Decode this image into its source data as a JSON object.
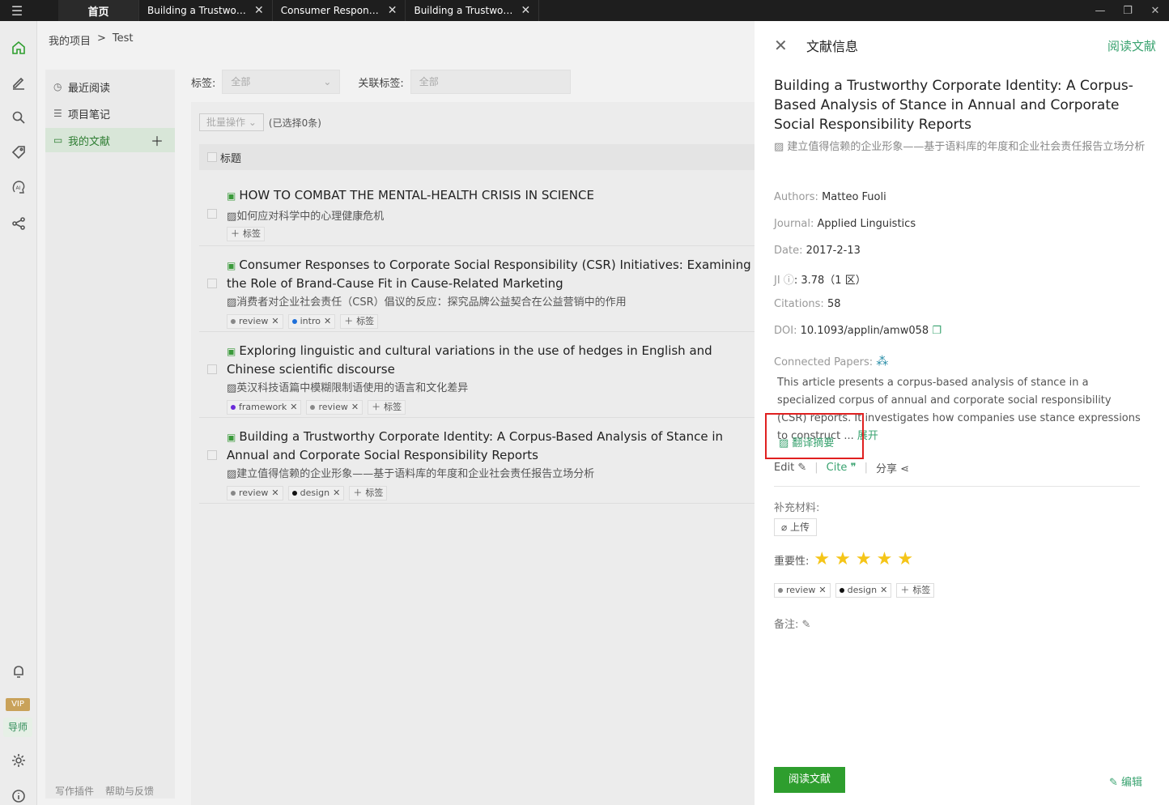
{
  "tabs": {
    "home": "首页",
    "items": [
      {
        "label": "Building a Trustworth..."
      },
      {
        "label": "Consumer Responses..."
      },
      {
        "label": "Building a Trustworth..."
      }
    ]
  },
  "breadcrumb": {
    "root": "我的项目",
    "sep": ">",
    "current": "Test"
  },
  "side_nav": {
    "recent": "最近阅读",
    "notes": "项目笔记",
    "my_docs": "我的文献"
  },
  "footer": {
    "plugins": "写作插件",
    "help": "帮助与反馈"
  },
  "rail": {
    "vip": "VIP",
    "mentor": "导师"
  },
  "filters": {
    "tag_label": "标签:",
    "tag_value": "全部",
    "related_label": "关联标签:",
    "related_value": "全部"
  },
  "list": {
    "batch_label": "批量操作",
    "selected": "(已选择0条)",
    "header_title": "标题",
    "add_tag": "标签",
    "rows": [
      {
        "title": "HOW TO COMBAT THE MENTAL-HEALTH CRISIS IN SCIENCE",
        "sub": "如何应对科学中的心理健康危机",
        "tags": []
      },
      {
        "title": "Consumer Responses to Corporate Social Responsibility (CSR) Initiatives: Examining the Role of Brand-Cause Fit in Cause-Related Marketing",
        "sub": "消费者对企业社会责任（CSR）倡议的反应：探究品牌公益契合在公益营销中的作用",
        "tags": [
          {
            "name": "review",
            "color": "#888888"
          },
          {
            "name": "intro",
            "color": "#1e6fd9"
          }
        ]
      },
      {
        "title": "Exploring linguistic and cultural variations in the use of hedges in English and Chinese scientific discourse",
        "sub": "英汉科技语篇中模糊限制语使用的语言和文化差异",
        "tags": [
          {
            "name": "framework",
            "color": "#6a2bd9"
          },
          {
            "name": "review",
            "color": "#888888"
          }
        ]
      },
      {
        "title": "Building a Trustworthy Corporate Identity: A Corpus-Based Analysis of Stance in Annual and Corporate Social Responsibility Reports",
        "sub": "建立值得信赖的企业形象——基于语料库的年度和企业社会责任报告立场分析",
        "tags": [
          {
            "name": "review",
            "color": "#888888"
          },
          {
            "name": "design",
            "color": "#111111"
          }
        ]
      }
    ]
  },
  "detail": {
    "header": "文献信息",
    "read_link": "阅读文献",
    "title": "Building a Trustworthy Corporate Identity: A Corpus-Based Analysis of Stance in Annual and Corporate Social Responsibility Reports",
    "title_trans": "建立值得信赖的企业形象——基于语料库的年度和企业社会责任报告立场分析",
    "authors_k": "Authors:",
    "authors_v": "Matteo Fuoli",
    "journal_k": "Journal:",
    "journal_v": "Applied Linguistics",
    "date_k": "Date:",
    "date_v": "2017-2-13",
    "ji_k": "JI",
    "ji_v": "3.78（1 区）",
    "citations_k": "Citations:",
    "citations_v": "58",
    "doi_k": "DOI:",
    "doi_v": "10.1093/applin/amw058",
    "connected_k": "Connected Papers:",
    "abstract": "This article presents a corpus-based analysis of stance in a specialized corpus of annual and corporate social responsibility (CSR) reports. It investigates how companies use stance expressions to construct ...",
    "expand": "展开",
    "translate": "翻译摘要",
    "edit": "Edit",
    "cite": "Cite",
    "share": "分享",
    "supp": "补充材料:",
    "upload": "上传",
    "importance": "重要性:",
    "importance_value": 5,
    "importance_max": 5,
    "tags": [
      {
        "name": "review",
        "color": "#888888"
      },
      {
        "name": "design",
        "color": "#111111"
      }
    ],
    "add_tag": "标签",
    "notes": "备注:",
    "read_btn": "阅读文献",
    "edit_btn": "编辑"
  },
  "colors": {
    "accent": "#3aa370",
    "primary_btn": "#2e9e2e",
    "highlight": "#e02020",
    "star": "#f5c518"
  }
}
